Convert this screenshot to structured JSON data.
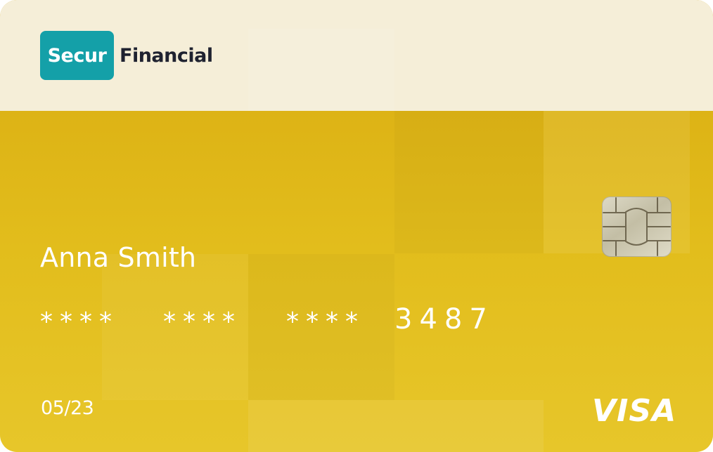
{
  "brand": {
    "badge": "Secur",
    "name": "Financial",
    "badge_color": "#14a0a8",
    "header_color": "#f5eed8"
  },
  "card": {
    "holder_name": "Anna Smith",
    "number_groups": [
      "****",
      "****",
      "****",
      "3487"
    ],
    "expiry": "05/23",
    "network": "VISA",
    "background_color": "#e0b817",
    "chip_icon": "emv-chip-icon"
  }
}
